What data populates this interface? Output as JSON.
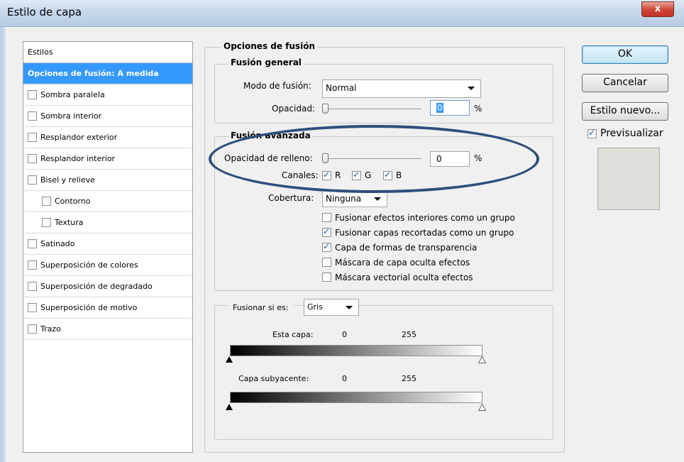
{
  "window": {
    "title": "Estilo de capa",
    "close_label": "x"
  },
  "styles": {
    "header": "Estilos",
    "items": [
      {
        "label": "Opciones de fusión: A medida",
        "selected": true,
        "checkbox": false,
        "checked": false
      },
      {
        "label": "Sombra paralela",
        "checkbox": true,
        "checked": false
      },
      {
        "label": "Sombra interior",
        "checkbox": true,
        "checked": false
      },
      {
        "label": "Resplandor exterior",
        "checkbox": true,
        "checked": false
      },
      {
        "label": "Resplandor interior",
        "checkbox": true,
        "checked": false
      },
      {
        "label": "Bisel y relieve",
        "checkbox": true,
        "checked": false
      },
      {
        "label": "Contorno",
        "checkbox": true,
        "checked": false,
        "sub": true
      },
      {
        "label": "Textura",
        "checkbox": true,
        "checked": false,
        "sub": true
      },
      {
        "label": "Satinado",
        "checkbox": true,
        "checked": false
      },
      {
        "label": "Superposición de colores",
        "checkbox": true,
        "checked": false
      },
      {
        "label": "Superposición de degradado",
        "checkbox": true,
        "checked": false
      },
      {
        "label": "Superposición de motivo",
        "checkbox": true,
        "checked": false
      },
      {
        "label": "Trazo",
        "checkbox": true,
        "checked": false
      }
    ]
  },
  "blend_options": {
    "title": "Opciones de fusión",
    "general": {
      "title": "Fusión general",
      "mode_label": "Modo de fusión:",
      "mode_value": "Normal",
      "opacity_label": "Opacidad:",
      "opacity_value": "0",
      "opacity_unit": "%",
      "opacity_level": 0
    },
    "advanced": {
      "title": "Fusión avanzada",
      "fill_opacity_label": "Opacidad de relleno:",
      "fill_opacity_value": "0",
      "fill_opacity_unit": "%",
      "fill_opacity_level": 0,
      "channels_label": "Canales:",
      "channel_r": "R",
      "channel_g": "G",
      "channel_b": "B",
      "knockout_label": "Cobertura:",
      "knockout_value": "Ninguna",
      "options": [
        {
          "label": "Fusionar efectos interiores como un grupo",
          "checked": false
        },
        {
          "label": "Fusionar capas recortadas como un grupo",
          "checked": true
        },
        {
          "label": "Capa de formas de transparencia",
          "checked": true
        },
        {
          "label": "Máscara de capa oculta efectos",
          "checked": false
        },
        {
          "label": "Máscara vectorial oculta efectos",
          "checked": false
        }
      ]
    },
    "blend_if": {
      "label": "Fusionar si es:",
      "value": "Gris",
      "this_layer_label": "Esta capa:",
      "this_layer_min": "0",
      "this_layer_max": "255",
      "underlying_label": "Capa subyacente:",
      "underlying_min": "0",
      "underlying_max": "255"
    }
  },
  "buttons": {
    "ok": "OK",
    "cancel": "Cancelar",
    "new_style": "Estilo nuevo...",
    "preview_label": "Previsualizar"
  },
  "colors": {
    "selection": "#3399ff",
    "annotation_ellipse": "#2d4f7c",
    "preview_swatch": "#e0ded9"
  }
}
